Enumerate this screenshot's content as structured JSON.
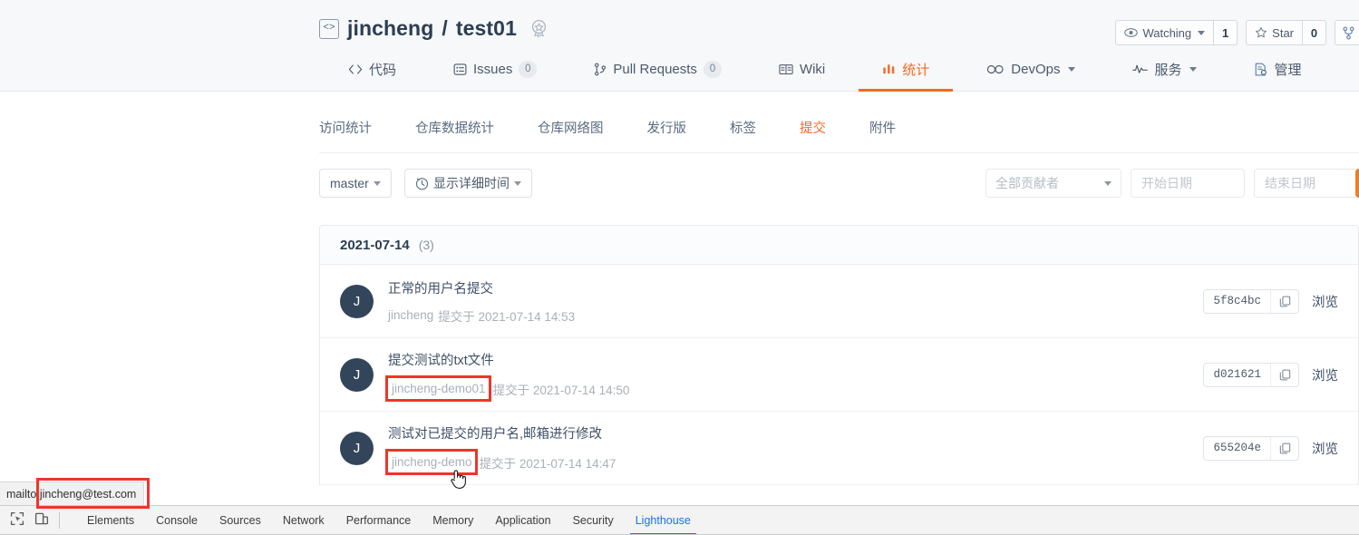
{
  "repo": {
    "icon": "code-repo-icon",
    "owner": "jincheng",
    "separator": "/",
    "name": "test01",
    "badge_icon": "award-badge-icon"
  },
  "header_actions": {
    "watching_icon": "eye-icon",
    "watching_label": "Watching",
    "watching_count": "1",
    "star_icon": "star-icon",
    "star_label": "Star",
    "star_count": "0",
    "fork_icon": "fork-icon"
  },
  "main_nav": [
    {
      "icon": "code-icon",
      "icon_glyph": "‹›",
      "label": "代码",
      "count": null,
      "active": false,
      "caret": false
    },
    {
      "icon": "issues-icon",
      "icon_glyph": "☷",
      "label": "Issues",
      "count": "0",
      "active": false,
      "caret": false
    },
    {
      "icon": "pull-request-icon",
      "icon_glyph": "⎇",
      "label": "Pull Requests",
      "count": "0",
      "active": false,
      "caret": false
    },
    {
      "icon": "wiki-icon",
      "icon_glyph": "▤",
      "label": "Wiki",
      "count": null,
      "active": false,
      "caret": false
    },
    {
      "icon": "statistics-icon",
      "icon_glyph": "▒",
      "label": "统计",
      "count": null,
      "active": true,
      "caret": false
    },
    {
      "icon": "devops-icon",
      "icon_glyph": "∞",
      "label": "DevOps",
      "count": null,
      "active": false,
      "caret": true
    },
    {
      "icon": "services-icon",
      "icon_glyph": "⌇",
      "label": "服务",
      "count": null,
      "active": false,
      "caret": true
    },
    {
      "icon": "manage-icon",
      "icon_glyph": "⚙",
      "label": "管理",
      "count": null,
      "active": false,
      "caret": false
    }
  ],
  "sub_nav": [
    {
      "label": "访问统计",
      "active": false
    },
    {
      "label": "仓库数据统计",
      "active": false
    },
    {
      "label": "仓库网络图",
      "active": false
    },
    {
      "label": "发行版",
      "active": false
    },
    {
      "label": "标签",
      "active": false
    },
    {
      "label": "提交",
      "active": true
    },
    {
      "label": "附件",
      "active": false
    }
  ],
  "toolbar": {
    "branch_label": "master",
    "time_icon": "clock-icon",
    "time_label": "显示详细时间",
    "contributor_placeholder": "全部贡献者",
    "start_date_placeholder": "开始日期",
    "end_date_placeholder": "结束日期",
    "search_button_icon": "search-icon",
    "search_button_color": "#f47b20"
  },
  "commit_group": {
    "date": "2021-07-14",
    "count": "(3)"
  },
  "commits": [
    {
      "avatar_initial": "J",
      "message": "正常的用户名提交",
      "author": "jincheng",
      "author_highlighted": false,
      "meta_suffix": "提交于 2021-07-14 14:53",
      "hash": "5f8c4bc",
      "copy_icon": "copy-icon",
      "browse_label": "浏览"
    },
    {
      "avatar_initial": "J",
      "message": "提交测试的txt文件",
      "author": "jincheng-demo01",
      "author_highlighted": true,
      "meta_suffix": "提交于 2021-07-14 14:50",
      "hash": "d021621",
      "copy_icon": "copy-icon",
      "browse_label": "浏览"
    },
    {
      "avatar_initial": "J",
      "message": "测试对已提交的用户名,邮箱进行修改",
      "author": "jincheng-demo",
      "author_highlighted": true,
      "meta_suffix": "提交于 2021-07-14 14:47",
      "hash": "655204e",
      "copy_icon": "copy-icon",
      "browse_label": "浏览"
    }
  ],
  "status_bar": {
    "text": "mailto:jincheng@test.com",
    "highlight_color": "#f0342b"
  },
  "devtools": {
    "inspect_icon": "inspect-element-icon",
    "device_icon": "device-toolbar-icon",
    "tabs": [
      {
        "label": "Elements",
        "active": false
      },
      {
        "label": "Console",
        "active": false
      },
      {
        "label": "Sources",
        "active": false
      },
      {
        "label": "Network",
        "active": false
      },
      {
        "label": "Performance",
        "active": false
      },
      {
        "label": "Memory",
        "active": false
      },
      {
        "label": "Application",
        "active": false
      },
      {
        "label": "Security",
        "active": false
      },
      {
        "label": "Lighthouse",
        "active": true
      }
    ],
    "active_color": "#1a73e8"
  }
}
